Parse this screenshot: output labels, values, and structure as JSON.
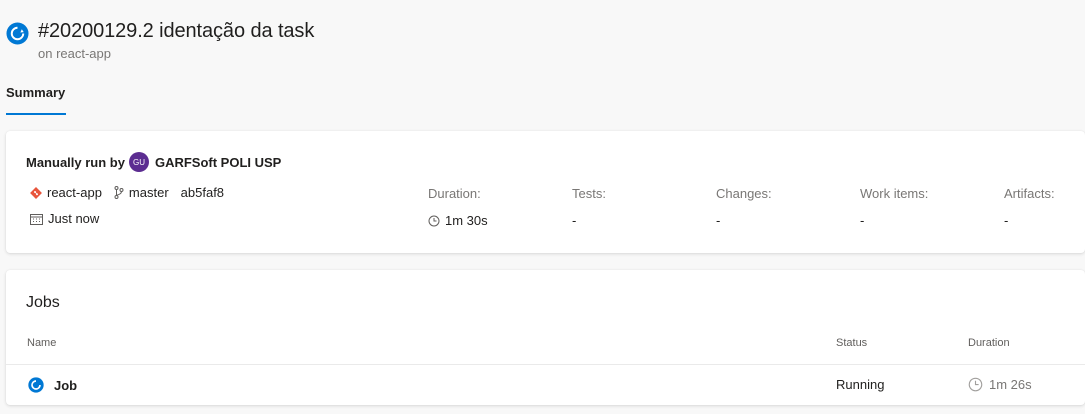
{
  "header": {
    "title": "#20200129.2 identação da task",
    "subtitle": "on react-app",
    "accent": "#0078d4"
  },
  "tabs": [
    {
      "label": "Summary",
      "active": true
    }
  ],
  "summary": {
    "run_label": "Manually run by",
    "avatar_initials": "GU",
    "user": "GARFSoft POLI USP",
    "repo": "react-app",
    "branch": "master",
    "commit": "ab5faf8",
    "time": "Just now",
    "stats": [
      {
        "label": "Duration:",
        "value": "1m 30s",
        "icon": "clock-icon"
      },
      {
        "label": "Tests:",
        "value": "-"
      },
      {
        "label": "Changes:",
        "value": "-"
      },
      {
        "label": "Work items:",
        "value": "-"
      },
      {
        "label": "Artifacts:",
        "value": "-"
      }
    ]
  },
  "jobs": {
    "title": "Jobs",
    "columns": {
      "name": "Name",
      "status": "Status",
      "duration": "Duration"
    },
    "rows": [
      {
        "name": "Job",
        "status": "Running",
        "duration": "1m 26s"
      }
    ]
  }
}
